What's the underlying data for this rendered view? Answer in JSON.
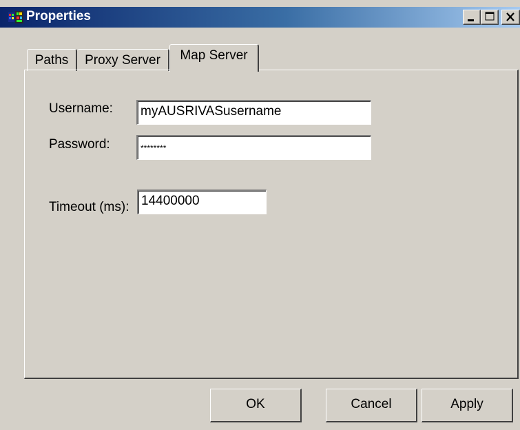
{
  "window": {
    "title": "Properties",
    "icon": "app-icon",
    "controls": {
      "minimize": "minimize-icon",
      "maximize": "maximize-icon",
      "close": "close-icon"
    }
  },
  "tabs": [
    {
      "label": "Paths",
      "selected": false
    },
    {
      "label": "Proxy Server",
      "selected": false
    },
    {
      "label": "Map Server",
      "selected": true
    }
  ],
  "form": {
    "username_label": "Username:",
    "username_value": "myAUSRIVASusername",
    "password_label": "Password:",
    "password_value": "********",
    "timeout_label": "Timeout (ms):",
    "timeout_value": "14400000"
  },
  "buttons": {
    "ok": "OK",
    "cancel": "Cancel",
    "apply": "Apply"
  },
  "colors": {
    "dialog_bg": "#d4d0c8",
    "titlebar_start": "#0a246a",
    "titlebar_end": "#a6caf0"
  }
}
